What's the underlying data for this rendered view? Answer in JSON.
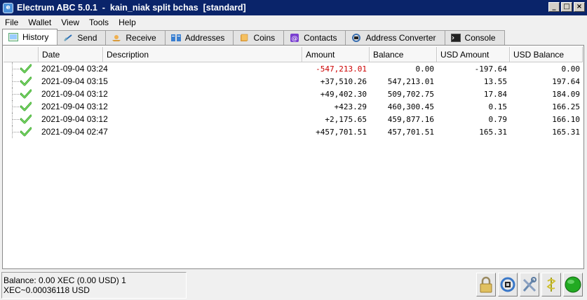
{
  "window": {
    "title": "Electrum ABC 5.0.1  -  kain_niak split bchas  [standard]"
  },
  "menu": [
    "File",
    "Wallet",
    "View",
    "Tools",
    "Help"
  ],
  "tabs": [
    {
      "label": "History",
      "icon": "history-icon",
      "active": true
    },
    {
      "label": "Send",
      "icon": "send-icon"
    },
    {
      "label": "Receive",
      "icon": "receive-icon"
    },
    {
      "label": "Addresses",
      "icon": "addresses-icon"
    },
    {
      "label": "Coins",
      "icon": "coins-icon"
    },
    {
      "label": "Contacts",
      "icon": "contacts-icon"
    },
    {
      "label": "Address Converter",
      "icon": "address-converter-icon"
    },
    {
      "label": "Console",
      "icon": "console-icon"
    }
  ],
  "history": {
    "columns": [
      "",
      "Date",
      "Description",
      "Amount",
      "Balance",
      "USD Amount",
      "USD Balance"
    ],
    "rows": [
      {
        "date": "2021-09-04 03:24",
        "description": "",
        "amount": "-547,213.01",
        "balance": "0.00",
        "usd_amount": "-197.64",
        "usd_balance": "0.00",
        "negative": true
      },
      {
        "date": "2021-09-04 03:15",
        "description": "",
        "amount": "+37,510.26",
        "balance": "547,213.01",
        "usd_amount": "13.55",
        "usd_balance": "197.64"
      },
      {
        "date": "2021-09-04 03:12",
        "description": "",
        "amount": "+49,402.30",
        "balance": "509,702.75",
        "usd_amount": "17.84",
        "usd_balance": "184.09"
      },
      {
        "date": "2021-09-04 03:12",
        "description": "",
        "amount": "+423.29",
        "balance": "460,300.45",
        "usd_amount": "0.15",
        "usd_balance": "166.25"
      },
      {
        "date": "2021-09-04 03:12",
        "description": "",
        "amount": "+2,175.65",
        "balance": "459,877.16",
        "usd_amount": "0.79",
        "usd_balance": "166.10"
      },
      {
        "date": "2021-09-04 02:47",
        "description": "",
        "amount": "+457,701.51",
        "balance": "457,701.51",
        "usd_amount": "165.31",
        "usd_balance": "165.31"
      }
    ]
  },
  "status": {
    "balance_text": "Balance: 0.00 XEC (0.00 USD) 1 XEC~0.00036118 USD",
    "buttons": [
      "lock-icon",
      "preferences-icon",
      "tools-icon",
      "seed-icon",
      "network-status-icon"
    ]
  },
  "colors": {
    "negative": "#cc0000",
    "titlebar": "#0a246a",
    "network_ok": "#22aa22"
  }
}
